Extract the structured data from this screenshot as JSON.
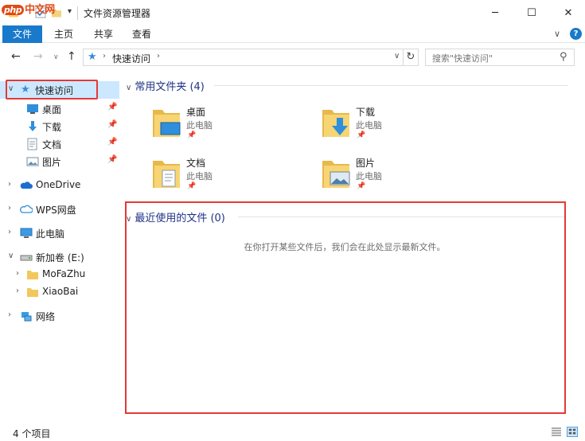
{
  "window": {
    "title": "文件资源管理器",
    "minimize": "─",
    "maximize": "☐",
    "close": "✕"
  },
  "watermark": {
    "badge": "php",
    "text": "中文网"
  },
  "ribbon": {
    "tabs": [
      {
        "label": "文件",
        "active": true
      },
      {
        "label": "主页"
      },
      {
        "label": "共享"
      },
      {
        "label": "查看"
      }
    ],
    "help": "?"
  },
  "address": {
    "path": "快速访问",
    "search_placeholder": "搜索\"快速访问\""
  },
  "nav": {
    "items": [
      {
        "label": "快速访问",
        "icon": "star-icon",
        "expanded": true,
        "selected": true
      },
      {
        "label": "桌面",
        "icon": "desktop-icon",
        "pinned": true
      },
      {
        "label": "下载",
        "icon": "download-icon",
        "pinned": true
      },
      {
        "label": "文档",
        "icon": "document-icon",
        "pinned": true
      },
      {
        "label": "图片",
        "icon": "picture-icon",
        "pinned": true
      },
      {
        "label": "OneDrive",
        "icon": "cloud-icon"
      },
      {
        "label": "WPS网盘",
        "icon": "wps-cloud-icon"
      },
      {
        "label": "此电脑",
        "icon": "computer-icon"
      },
      {
        "label": "新加卷 (E:)",
        "icon": "drive-icon",
        "expanded": true
      },
      {
        "label": "MoFaZhu",
        "icon": "folder-icon"
      },
      {
        "label": "XiaoBai",
        "icon": "folder-icon"
      },
      {
        "label": "网络",
        "icon": "network-icon"
      }
    ]
  },
  "content": {
    "frequent_header": "常用文件夹 (4)",
    "frequent": [
      {
        "name": "桌面",
        "location": "此电脑",
        "icon": "desktop-folder-icon"
      },
      {
        "name": "下载",
        "location": "此电脑",
        "icon": "download-folder-icon"
      },
      {
        "name": "文档",
        "location": "此电脑",
        "icon": "document-folder-icon"
      },
      {
        "name": "图片",
        "location": "此电脑",
        "icon": "picture-folder-icon"
      }
    ],
    "recent_header": "最近使用的文件 (0)",
    "recent_empty": "在你打开某些文件后，我们会在此处显示最新文件。"
  },
  "status": {
    "count": "4 个项目"
  },
  "colors": {
    "accent": "#1979ca",
    "selection": "#cce8ff",
    "header": "#1e3287",
    "highlight_box": "#e53935"
  }
}
